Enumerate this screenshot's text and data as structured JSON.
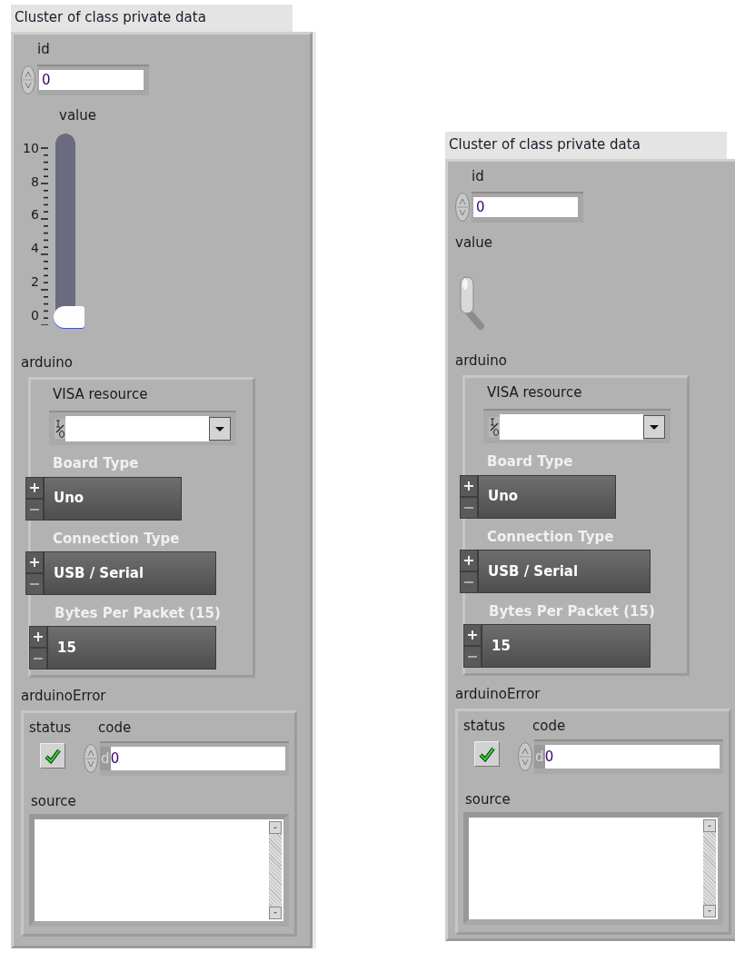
{
  "clusters": [
    {
      "title": "Cluster of class private data",
      "id": {
        "label": "id",
        "value": "0"
      },
      "value": {
        "label": "value",
        "kind": "slide",
        "scale": [
          "10",
          "8",
          "6",
          "4",
          "2",
          "0"
        ],
        "level": 0
      },
      "arduino": {
        "label": "arduino",
        "visa": {
          "label": "VISA resource"
        },
        "rings": [
          {
            "label": "Board Type",
            "value": "Uno"
          },
          {
            "label": "Connection Type",
            "value": "USB / Serial"
          },
          {
            "label": "Bytes Per Packet (15)",
            "value": "15"
          }
        ]
      },
      "error": {
        "label": "arduinoError",
        "status": {
          "label": "status",
          "checked": true
        },
        "code": {
          "label": "code",
          "radix": "d",
          "value": "0"
        },
        "source": {
          "label": "source"
        }
      }
    },
    {
      "title": "Cluster of class private data",
      "id": {
        "label": "id",
        "value": "0"
      },
      "value": {
        "label": "value",
        "kind": "toggle",
        "on": false
      },
      "arduino": {
        "label": "arduino",
        "visa": {
          "label": "VISA resource"
        },
        "rings": [
          {
            "label": "Board Type",
            "value": "Uno"
          },
          {
            "label": "Connection Type",
            "value": "USB / Serial"
          },
          {
            "label": "Bytes Per Packet (15)",
            "value": "15"
          }
        ]
      },
      "error": {
        "label": "arduinoError",
        "status": {
          "label": "status",
          "checked": true
        },
        "code": {
          "label": "code",
          "radix": "d",
          "value": "0"
        },
        "source": {
          "label": "source"
        }
      }
    }
  ]
}
